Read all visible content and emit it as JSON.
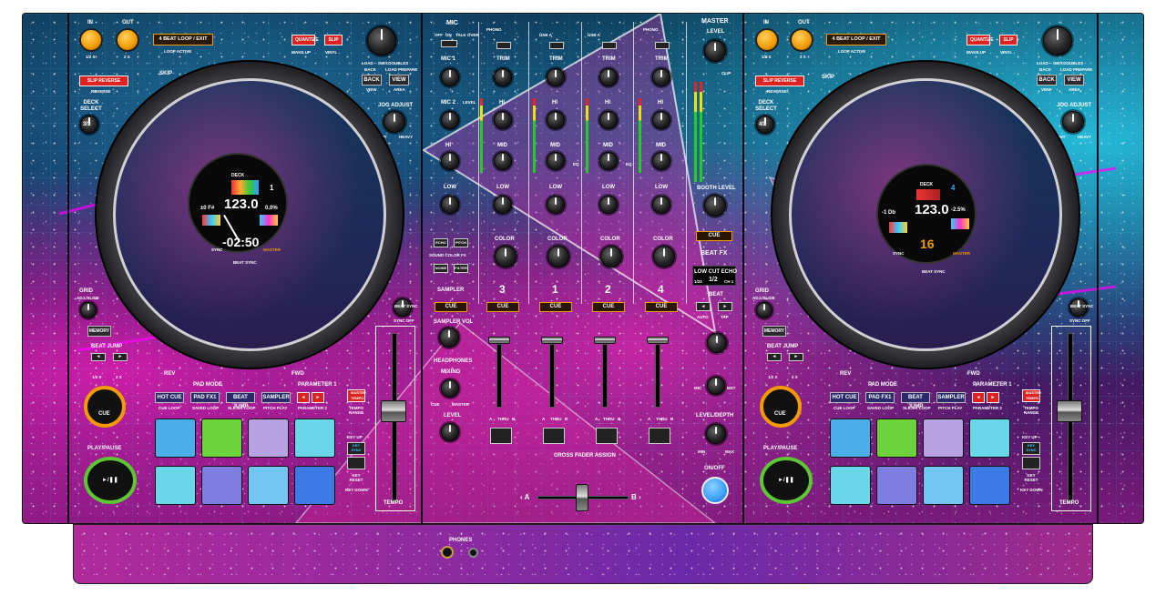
{
  "left_deck": {
    "in_label": "IN",
    "out_label": "OUT",
    "half_x": "1/2 X",
    "two_x": "2 X",
    "beat_loop": "4 BEAT LOOP / EXIT",
    "loop_active": "LOOP ACTIVE",
    "quantize": "QUANTIZE",
    "slip": "SLIP",
    "wake_up": "WAKE UP",
    "vinyl": "VINYL",
    "slip_reverse": "SLIP REVERSE",
    "reverse": "REVERSE",
    "load": "LOAD ·· INST.DOUBLES",
    "back_small": "BACK",
    "load_prepare": "LOAD PREPARE",
    "back": "BACK",
    "view": "VIEW",
    "view_small": "VIEW",
    "area": "AREA",
    "deck_select": "DECK\nSELECT",
    "deck_31": "3/1",
    "jog_adjust": "JOG ADJUST",
    "light": "LIGHT",
    "heavy": "HEAVY",
    "skip": "SKIP",
    "grid": "GRID",
    "adj_slide": "ADJ./SLIDE",
    "memory": "MEMORY",
    "beat_jump": "BEAT JUMP",
    "rev": "REV",
    "fwd": "FWD",
    "pad_mode": "PAD MODE",
    "parameter1": "PARAMETER 1",
    "master_tempo": "MASTER TEMPO",
    "hot_cue": "HOT CUE",
    "pad_fx1": "PAD FX1",
    "beat_jump_btn": "BEAT JUMP",
    "sampler": "SAMPLER",
    "cue_loop": "CUE LOOP",
    "saved_loop": "SAVED LOOP",
    "slicer_loop": "SLICER LOOP",
    "pitch_play": "PITCH PLAY",
    "parameter2": "PARAMETER 2",
    "tempo_range": "TEMPO RANGE",
    "cue": "CUE",
    "play_pause": "PLAY/PAUSE",
    "play_glyph": "►/❚❚",
    "key_up": "KEY UP",
    "key_sync": "KEY SYNC",
    "key_reset": "KEY RESET",
    "key_down": "KEY DOWN",
    "beat_sync": "BEAT SYNC",
    "sync_off": "SYNC OFF",
    "tempo": "TEMPO",
    "screen": {
      "deck_label": "DECK",
      "deck_num": "1",
      "bpm": "123.0",
      "key": "±0 F#",
      "pitch": "0.0%",
      "time": "-02:50",
      "sync": "SYNC",
      "beat_sync": "BEAT SYNC",
      "master": "MASTER"
    }
  },
  "right_deck": {
    "screen": {
      "deck_label": "DECK",
      "deck_num": "4",
      "bpm": "123.0",
      "key": "-1 Db",
      "pitch": "-2.5%",
      "time": "16",
      "sync": "SYNC",
      "beat_sync": "BEAT SYNC",
      "master": "MASTER"
    },
    "deck_31": "4/2"
  },
  "mixer": {
    "mic": "MIC",
    "off": "OFF",
    "on": "ON",
    "talk_over": "TALK OVER",
    "mic1": "MIC 1",
    "mic2": "MIC 2",
    "level": "LEVEL",
    "hi": "HI",
    "mid": "MID",
    "low": "LOW",
    "trim": "TRIM",
    "eq": "EQ",
    "color": "COLOR",
    "low_small": "LOW",
    "hi_small": "HI",
    "phono": "PHONO",
    "line": "LINE",
    "usb_a": "USB A",
    "usb_b": "USB B",
    "echo": "ECHO",
    "pitch": "PITCH",
    "sound_color_fx": "SOUND COLOR FX",
    "noise": "NOISE",
    "filter": "FILTER",
    "sampler": "SAMPLER",
    "cue": "CUE",
    "sampler_vol": "SAMPLER VOL",
    "headphones": "HEADPHONES",
    "mixing": "MIXING",
    "cue_small": "CUE",
    "master_small": "MASTER",
    "level_hp": "LEVEL",
    "channels": [
      "3",
      "1",
      "2",
      "4"
    ],
    "thru": "THRU",
    "a": "A",
    "b": "B",
    "cross_fader_assign": "CROSS FADER ASSIGN",
    "cf_a": "‹ A",
    "cf_b": "B ›",
    "master": "MASTER",
    "master_level": "LEVEL",
    "clip": "CLIP",
    "booth_level": "BOOTH LEVEL",
    "beat_fx": "BEAT FX",
    "fx_display": "LOW CUT ECHO",
    "fx_fraction": "1/2",
    "fx_ch": "CH 1",
    "fx_ratio": "1/20",
    "beat": "BEAT",
    "auto": "AUTO",
    "tap": "TAP",
    "level_depth": "LEVEL/DEPTH",
    "min": "MIN",
    "max": "MAX",
    "on_off": "ON/OFF",
    "mic_small": "MIC",
    "mst": "MST",
    "phones": "PHONES"
  },
  "colors": {
    "orange": "#f29a00",
    "pad_blue": "#4aaee8",
    "pad_green": "#6cd43a",
    "pad_lilac": "#b7a2e4",
    "pad_cyan": "#6ad6ea",
    "pad_violet": "#7d7ee0",
    "pad_sky": "#74c6f2",
    "pad_royal": "#3c7ae6",
    "onoff_blue": "#3aa0ff"
  }
}
